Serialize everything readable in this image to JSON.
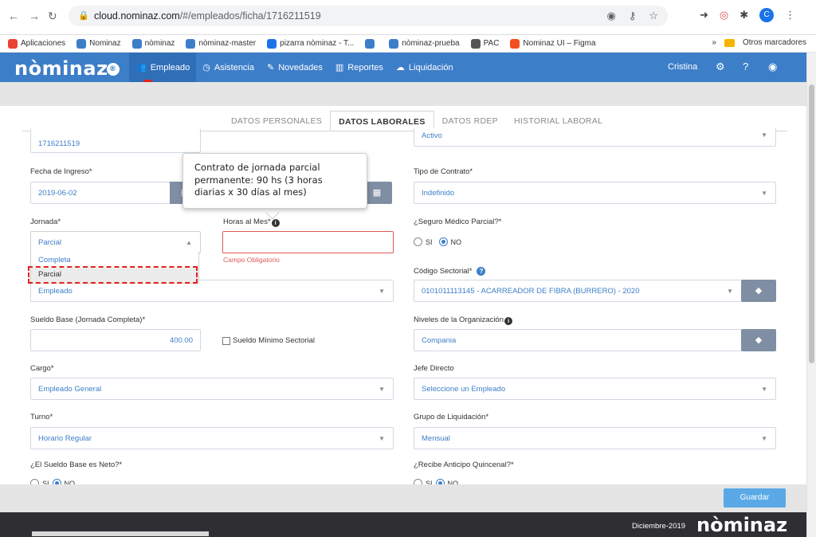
{
  "browser": {
    "url_host": "cloud.nominaz.com",
    "url_path": "/#/empleados/ficha/1716211519",
    "avatar_letter": "C",
    "bookmarks": [
      {
        "label": "Aplicaciones",
        "color": "#ea4335"
      },
      {
        "label": "Nominaz",
        "color": "#3d7ec9"
      },
      {
        "label": "nòminaz",
        "color": "#3d7ec9"
      },
      {
        "label": "nòminaz-master",
        "color": "#3d7ec9"
      },
      {
        "label": "pizarra nòminaz - T...",
        "color": "#1a73e8"
      },
      {
        "label": "",
        "color": "#3d7ec9"
      },
      {
        "label": "nòminaz-prueba",
        "color": "#3d7ec9"
      },
      {
        "label": "PAC",
        "color": "#555555"
      },
      {
        "label": "Nominaz UI – Figma",
        "color": "#f24e1e"
      }
    ],
    "more_label": "»",
    "other_bookmarks": "Otros marcadores"
  },
  "app": {
    "logo": "nòminaz",
    "nav": [
      "Empleado",
      "Asistencia",
      "Novedades",
      "Reportes",
      "Liquidación"
    ],
    "user": "Cristina",
    "accent": "#3d7ec9"
  },
  "tabs": [
    "DATOS PERSONALES",
    "DATOS LABORALES",
    "DATOS RDEP",
    "HISTORIAL LABORAL"
  ],
  "form": {
    "id_value": "1716211519",
    "estado_value": "Activo",
    "fecha_ingreso_label": "Fecha de Ingreso*",
    "fecha_ingreso_value": "2019-06-02",
    "tipo_contrato_label": "Tipo de Contrato*",
    "tipo_contrato_value": "Indefinido",
    "jornada_label": "Jornada*",
    "jornada_value": "Parcial",
    "jornada_options": [
      "Completa",
      "Parcial"
    ],
    "horas_label": "Horas al Mes*",
    "horas_error": "Campo Obligatorio",
    "seguro_label": "¿Seguro Médico Parcial?*",
    "si_label": "SI",
    "no_label": "NO",
    "codigo_label": "Código Sectorial*",
    "codigo_value": "0101011113145 - ACARREADOR DE FIBRA (BURRERO) - 2020",
    "tipo_empleado_value": "Empleado",
    "sueldo_label": "Sueldo Base (Jornada Completa)*",
    "sueldo_value": "400.00",
    "sueldo_minimo_label": "Sueldo Mínimo Sectorial",
    "niveles_label": "Niveles de la Organización",
    "niveles_value": "Compania",
    "cargo_label": "Cargo*",
    "cargo_value": "Empleado General",
    "jefe_label": "Jefe Directo",
    "jefe_value": "Seleccione un Empleado",
    "turno_label": "Turno*",
    "turno_value": "Horario Regular",
    "grupo_label": "Grupo de Liquidación*",
    "grupo_value": "Mensual",
    "neto_label": "¿El Sueldo Base es Neto?*",
    "anticipo_label": "¿Recibe Anticipo Quincenal?*",
    "partial_radio_label": "SI"
  },
  "tooltip": "Contrato de jornada parcial permanente: 90 hs (3 horas diarias x 30 días al mes)",
  "footer": {
    "save_label": "Guardar",
    "date": "Diciembre-2019",
    "logo": "nòminaz"
  }
}
